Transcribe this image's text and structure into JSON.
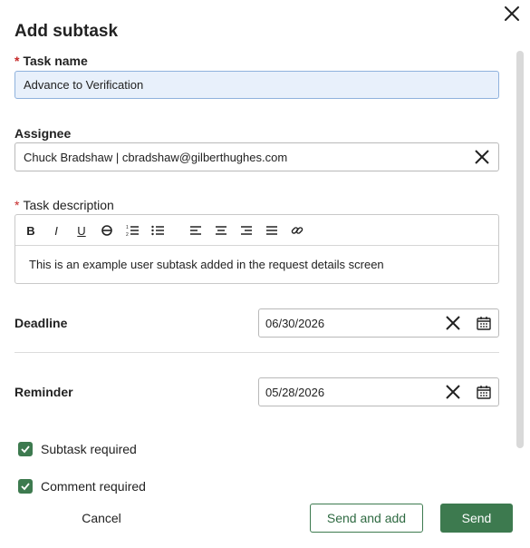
{
  "dialog": {
    "title": "Add subtask"
  },
  "form": {
    "task_name": {
      "label": "Task name",
      "required_mark": "*",
      "value": "Advance to Verification"
    },
    "assignee": {
      "label": "Assignee",
      "value": "Chuck Bradshaw | cbradshaw@gilberthughes.com"
    },
    "task_description": {
      "label": "Task description",
      "required_mark": "*",
      "toolbar": [
        "bold-icon",
        "italic-icon",
        "underline-icon",
        "strikethrough-icon",
        "ordered-list-icon",
        "bullet-list-icon",
        "align-left-icon",
        "align-center-icon",
        "align-right-icon",
        "justify-icon",
        "link-icon"
      ],
      "body": "This is an example user subtask added in the request details screen"
    },
    "deadline": {
      "label": "Deadline",
      "value": "06/30/2026"
    },
    "reminder": {
      "label": "Reminder",
      "value": "05/28/2026"
    },
    "checkboxes": [
      {
        "label": "Subtask required",
        "checked": true
      },
      {
        "label": "Comment required",
        "checked": true
      }
    ]
  },
  "footer": {
    "cancel_label": "Cancel",
    "send_and_add_label": "Send and add",
    "send_label": "Send"
  },
  "colors": {
    "accent": "#3d7a4f",
    "required": "#c62828",
    "focused_field": "#e8f0fb"
  }
}
